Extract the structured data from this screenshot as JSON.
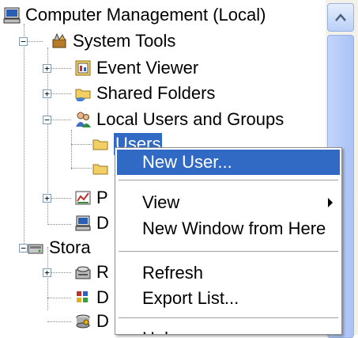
{
  "tree": {
    "root": {
      "label": "Computer Management (Local)",
      "icon": "computer-management-icon"
    },
    "system_tools": {
      "label": "System Tools",
      "icon": "system-tools-icon"
    },
    "event_viewer": {
      "label": "Event Viewer",
      "icon": "event-viewer-icon"
    },
    "shared_folders": {
      "label": "Shared Folders",
      "icon": "shared-folders-icon"
    },
    "local_users": {
      "label": "Local Users and Groups",
      "icon": "users-groups-icon"
    },
    "users": {
      "label": "Users",
      "icon": "folder-icon",
      "selected": true
    },
    "groups": {
      "icon": "folder-icon"
    },
    "performance": {
      "label": "P",
      "icon": "performance-logs-icon"
    },
    "device_manager": {
      "label": "D",
      "icon": "device-manager-icon"
    },
    "storage": {
      "label": "Stora",
      "icon": "storage-icon"
    },
    "removable": {
      "label": "R",
      "icon": "removable-storage-icon"
    },
    "defrag": {
      "label": "D",
      "icon": "disk-defragmenter-icon"
    },
    "disk_mgmt": {
      "label": "D",
      "icon": "disk-management-icon"
    }
  },
  "context_menu": {
    "new_user": "New User...",
    "view": "View",
    "new_window": "New Window from Here",
    "refresh": "Refresh",
    "export_list": "Export List...",
    "help": "Help"
  },
  "colors": {
    "selection": "#316ac5",
    "scrollbar_thumb": "#b9cdf8",
    "menu_border": "#8f8f8f"
  }
}
